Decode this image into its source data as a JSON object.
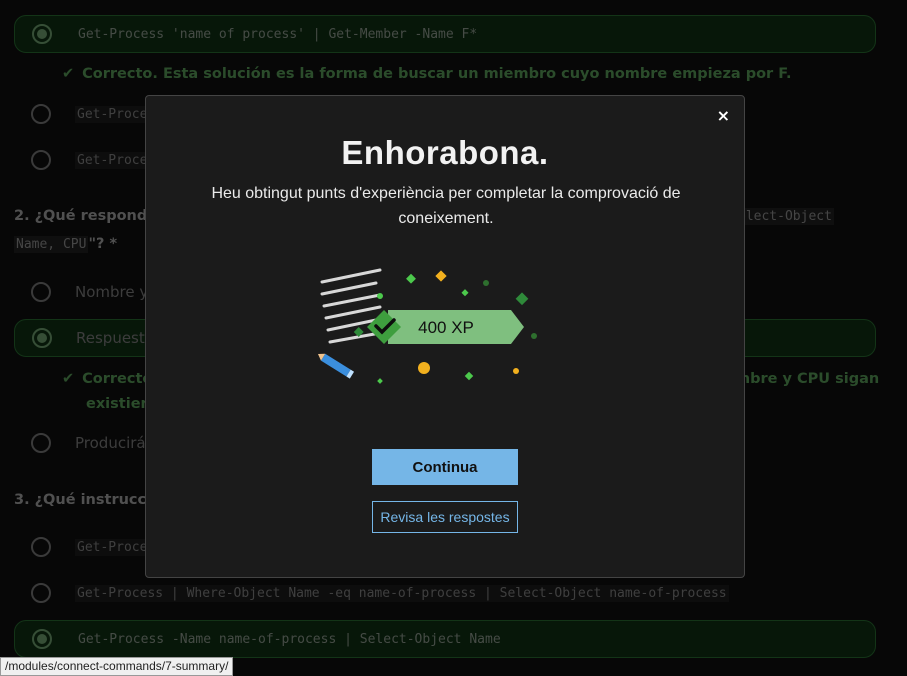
{
  "background": {
    "q1_options": [
      {
        "text": "Get-Process 'name of process' | Get-Member -Name F*",
        "selected": true
      },
      {
        "text": "Get-Proce",
        "selected": false
      },
      {
        "text": "Get-Proce",
        "selected": false
      }
    ],
    "q1_feedback": "Correcto. Esta solución es la forma de buscar un miembro cuyo nombre empieza por F.",
    "q2_question_prefix": "2. ¿Qué responder",
    "q2_question_code": "elect-Object",
    "q2_question_code2": "Name, CPU",
    "q2_question_suffix": "\"? *",
    "q2_options": [
      {
        "text": "Nombre y",
        "selected": false
      },
      {
        "text": "Respuesta",
        "selected": true
      },
      {
        "text": "Producirá",
        "selected": false
      }
    ],
    "q2_feedback_left": "Correcto",
    "q2_feedback_right": "mbre y CPU sigan",
    "q2_feedback_line2": "existien",
    "q3_question": "3. ¿Qué instrucció",
    "q3_options": [
      {
        "text": "Get-Proce",
        "selected": false
      },
      {
        "text": "Get-Process | Where-Object Name -eq name-of-process | Select-Object name-of-process",
        "selected": false
      },
      {
        "text": "Get-Process -Name name-of-process | Select-Object Name",
        "selected": true
      }
    ],
    "status_url": "/modules/connect-commands/7-summary/"
  },
  "modal": {
    "close_label": "×",
    "title": "Enhorabona.",
    "subtitle": "Heu obtingut punts d'experiència per completar la comprovació de coneixement.",
    "xp_badge": "400 XP",
    "primary_button": "Continua",
    "secondary_button": "Revisa les respostes"
  },
  "colors": {
    "accent": "#75b6e7",
    "success": "#6fcf6f",
    "selected_bg": "#0d3a14",
    "badge_green": "#7fbf7f"
  }
}
